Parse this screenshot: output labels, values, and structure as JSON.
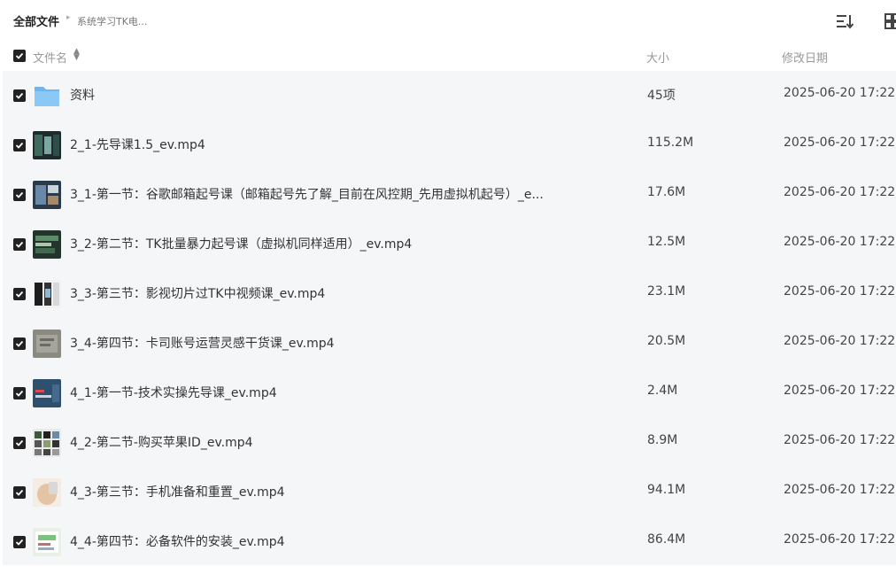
{
  "breadcrumb": {
    "root": "全部文件",
    "current": "系统学习TK电..."
  },
  "header": {
    "name": "文件名",
    "size": "大小",
    "date": "修改日期"
  },
  "colors": {
    "folder": "#8cc8f5",
    "check": "#222222",
    "list_bg": "#f5f6f8"
  },
  "files": [
    {
      "name": "资料",
      "size": "45项",
      "date": "2025-06-20 17:22",
      "type": "folder"
    },
    {
      "name": "2_1-先导课1.5_ev.mp4",
      "size": "115.2M",
      "date": "2025-06-20 17:22",
      "type": "video"
    },
    {
      "name": "3_1-第一节：谷歌邮箱起号课（邮箱起号先了解_目前在风控期_先用虚拟机起号）_e...",
      "size": "17.6M",
      "date": "2025-06-20 17:22",
      "type": "video"
    },
    {
      "name": "3_2-第二节：TK批量暴力起号课（虚拟机同样适用）_ev.mp4",
      "size": "12.5M",
      "date": "2025-06-20 17:22",
      "type": "video"
    },
    {
      "name": "3_3-第三节：影视切片过TK中视频课_ev.mp4",
      "size": "23.1M",
      "date": "2025-06-20 17:22",
      "type": "video"
    },
    {
      "name": "3_4-第四节：卡司账号运营灵感干货课_ev.mp4",
      "size": "20.5M",
      "date": "2025-06-20 17:22",
      "type": "video"
    },
    {
      "name": "4_1-第一节-技术实操先导课_ev.mp4",
      "size": "2.4M",
      "date": "2025-06-20 17:22",
      "type": "video"
    },
    {
      "name": "4_2-第二节-购买苹果ID_ev.mp4",
      "size": "8.9M",
      "date": "2025-06-20 17:22",
      "type": "video"
    },
    {
      "name": "4_3-第三节：手机准备和重置_ev.mp4",
      "size": "94.1M",
      "date": "2025-06-20 17:22",
      "type": "video"
    },
    {
      "name": "4_4-第四节：必备软件的安装_ev.mp4",
      "size": "86.4M",
      "date": "2025-06-20 17:22",
      "type": "video"
    }
  ]
}
